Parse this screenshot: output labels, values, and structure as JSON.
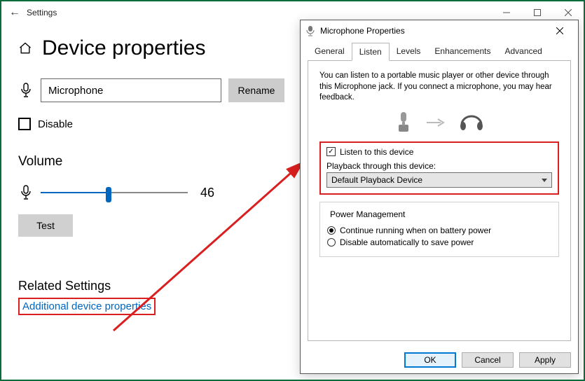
{
  "settings": {
    "window_title": "Settings",
    "page_title": "Device properties",
    "device_name": "Microphone",
    "rename_btn": "Rename",
    "disable_label": "Disable",
    "volume_heading": "Volume",
    "volume_value": "46",
    "test_btn": "Test",
    "related_heading": "Related Settings",
    "additional_link": "Additional device properties"
  },
  "dialog": {
    "title": "Microphone Properties",
    "tabs": {
      "general": "General",
      "listen": "Listen",
      "levels": "Levels",
      "enhancements": "Enhancements",
      "advanced": "Advanced"
    },
    "active_tab": "Listen",
    "description": "You can listen to a portable music player or other device through this Microphone jack.  If you connect a microphone, you may hear feedback.",
    "listen_checkbox": "Listen to this device",
    "listen_checked": true,
    "playback_label": "Playback through this device:",
    "playback_value": "Default Playback Device",
    "power_legend": "Power Management",
    "power_option_continue": "Continue running when on battery power",
    "power_option_disable": "Disable automatically to save power",
    "power_selected": "continue",
    "buttons": {
      "ok": "OK",
      "cancel": "Cancel",
      "apply": "Apply"
    }
  }
}
